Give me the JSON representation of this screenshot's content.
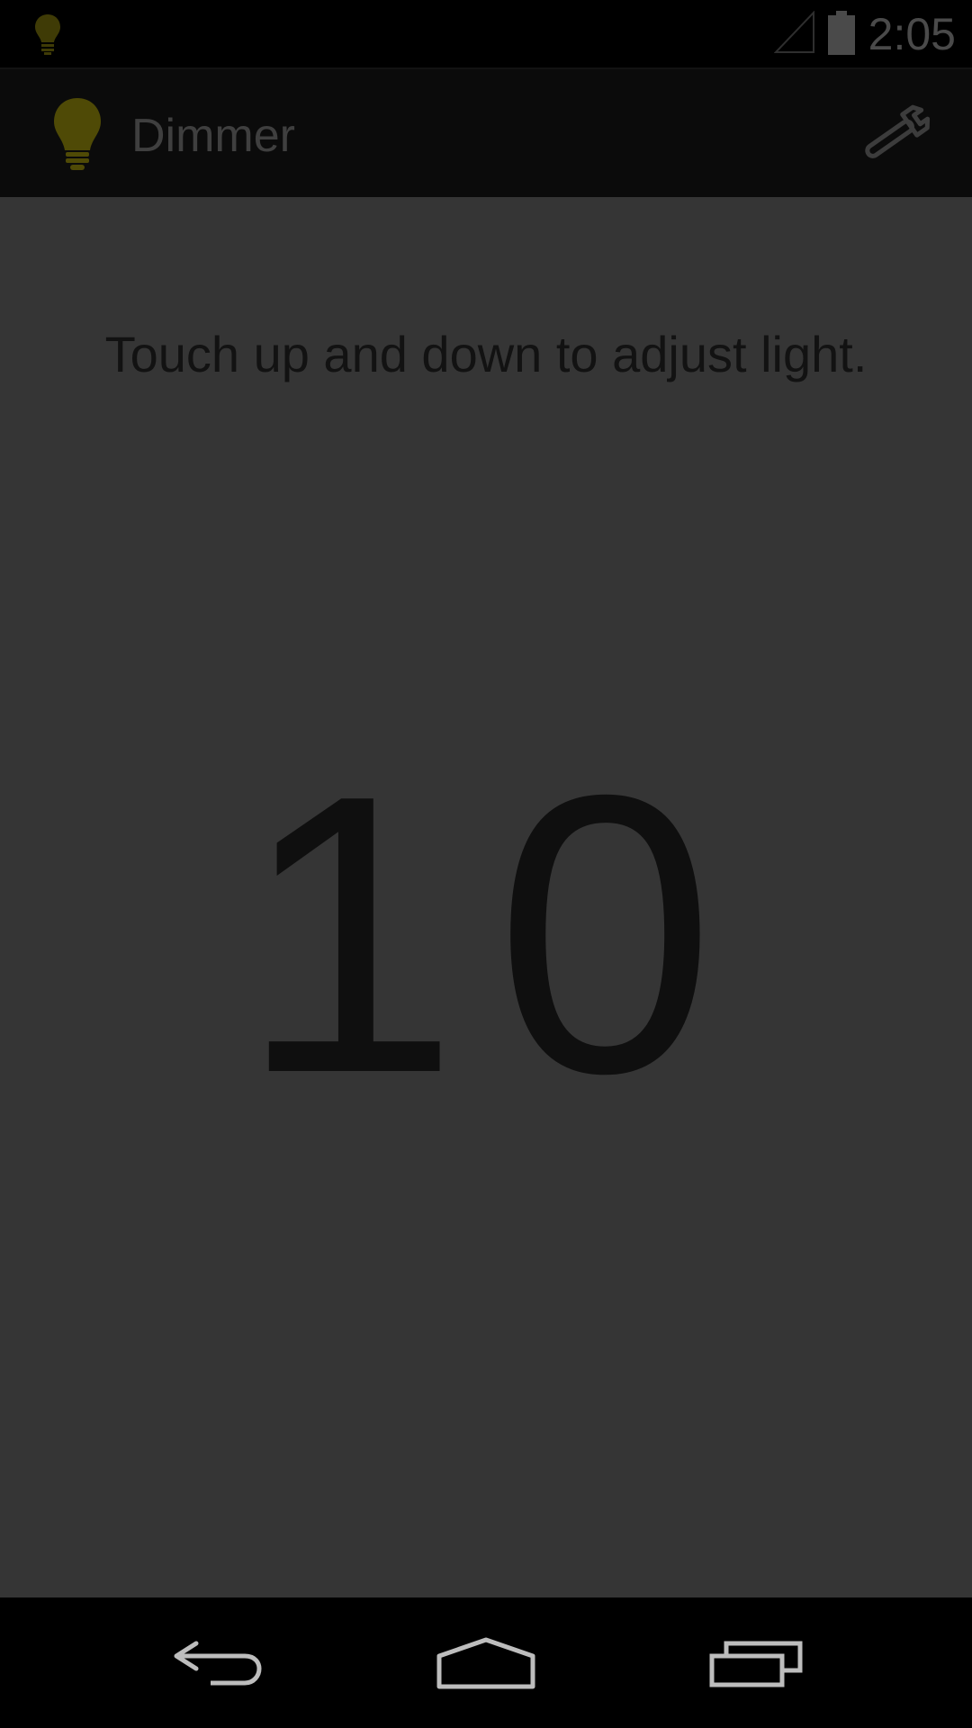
{
  "status_bar": {
    "time": "2:05",
    "notification_icon": "lightbulb-icon",
    "signal_icon": "signal-icon",
    "battery_icon": "battery-icon"
  },
  "action_bar": {
    "app_icon": "lightbulb-icon",
    "title": "Dimmer",
    "settings_icon": "wrench-icon"
  },
  "main": {
    "instructions": "Touch up and down to adjust light.",
    "brightness_value": "10"
  },
  "nav_bar": {
    "back_icon": "back-icon",
    "home_icon": "home-icon",
    "recents_icon": "recents-icon"
  },
  "colors": {
    "accent_bulb": "#4f4a06",
    "background": "#353535",
    "bars": "#000000"
  }
}
